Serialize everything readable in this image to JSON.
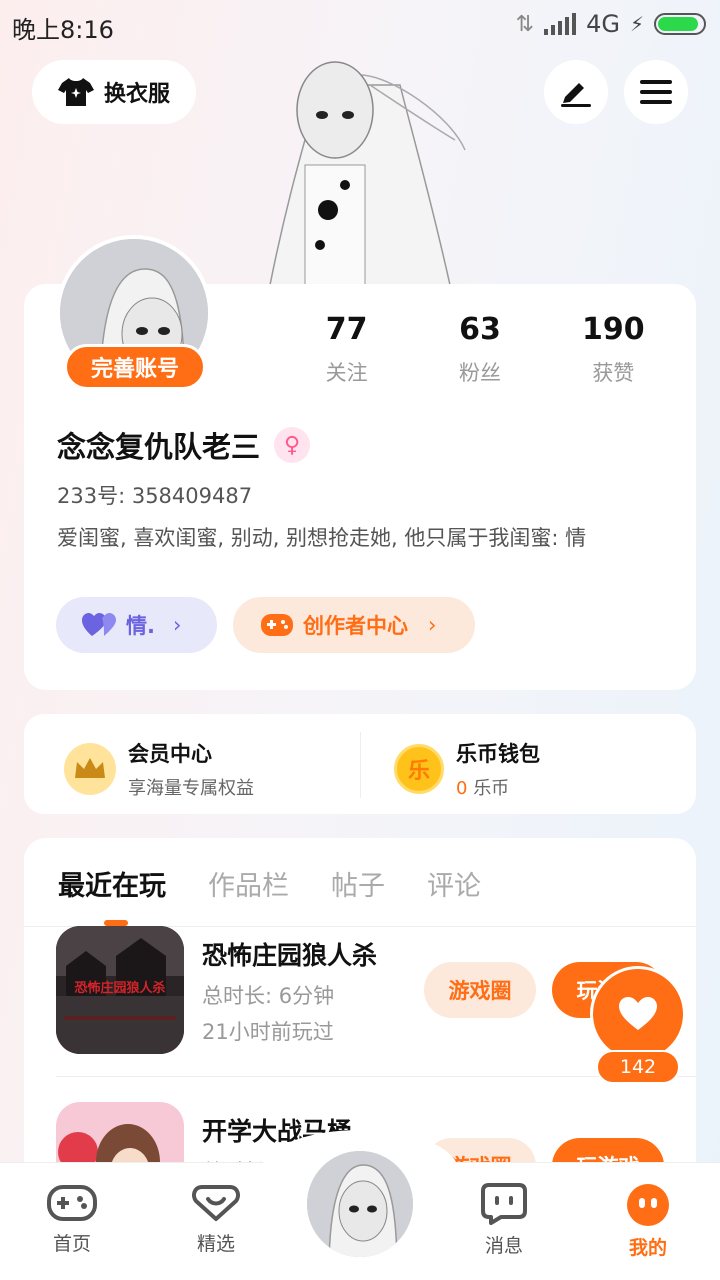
{
  "status": {
    "time": "晚上8:16",
    "network": "4G"
  },
  "header": {
    "dress_label": "换衣服"
  },
  "profile": {
    "complete_label": "完善账号",
    "stats": [
      {
        "value": "77",
        "label": "关注"
      },
      {
        "value": "63",
        "label": "粉丝"
      },
      {
        "value": "190",
        "label": "获赞"
      }
    ],
    "name": "念念复仇队老三",
    "uid": "233号: 358409487",
    "bio": "爱闺蜜, 喜欢闺蜜, 别动, 别想抢走她, 他只属于我闺蜜: 情",
    "love_pill": "情.",
    "creator_pill": "创作者中心"
  },
  "vip": {
    "member_title": "会员中心",
    "member_sub": "享海量专属权益",
    "wallet_title": "乐币钱包",
    "wallet_value": "0",
    "wallet_unit": "乐币",
    "coin_char": "乐"
  },
  "tabs": [
    "最近在玩",
    "作品栏",
    "帖子",
    "评论"
  ],
  "games": [
    {
      "title": "恐怖庄园狼人杀",
      "duration": "总时长: 6分钟",
      "last_played": "21小时前玩过",
      "icon_text": "恐怖庄园狼人杀",
      "circle_label": "游戏圈",
      "play_label": "玩游戏"
    },
    {
      "title": "开学大战马桶",
      "duration": "总时长",
      "circle_label": "游戏圈",
      "play_label": "玩游戏"
    }
  ],
  "float_like": {
    "count": "142"
  },
  "nav": [
    {
      "label": "首页",
      "icon": "gamepad-icon"
    },
    {
      "label": "精选",
      "icon": "heart-chat-icon"
    },
    {
      "label": "消息",
      "icon": "message-icon"
    },
    {
      "label": "我的",
      "icon": "profile-face-icon"
    }
  ],
  "colors": {
    "accent": "#ff6e14",
    "love": "#6b63e0",
    "gender": "#ff5a8c"
  }
}
